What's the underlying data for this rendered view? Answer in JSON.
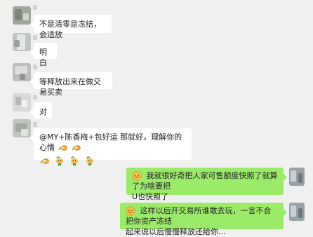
{
  "messages": [
    {
      "side": "left",
      "text": "不是清零是冻结，会适放"
    },
    {
      "side": "left",
      "text": "明白"
    },
    {
      "side": "left",
      "text": "等释放出来在做交易买卖"
    },
    {
      "side": "left",
      "text": "对"
    },
    {
      "side": "left",
      "text": "@MY+陈香梅+包好运 那就好，理解你的心情"
    },
    {
      "side": "right",
      "line1": "我就很好奇把人家可售额度快照了就算了为啥要把",
      "line2": "U也快照了"
    },
    {
      "side": "right",
      "line1": "这样以后开交易所谁敢去玩，一言不合把你资产冻结",
      "line2": "起来说以后慢慢释放还给你..."
    }
  ],
  "icons": {
    "ok_hand": "ok-hand-emoji",
    "plant": "sprout-emoji",
    "face": "embarrassed-face-emoji"
  },
  "colors": {
    "background": "#f0f0f0",
    "incoming_bubble": "#ffffff",
    "outgoing_bubble": "#9bea6a"
  }
}
